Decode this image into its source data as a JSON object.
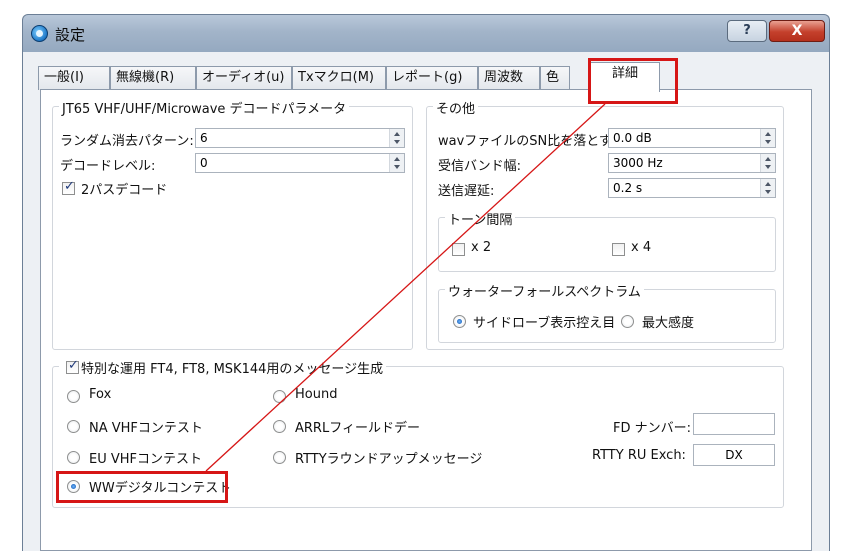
{
  "window": {
    "title": "設定",
    "help_label": "?",
    "close_label": "X"
  },
  "tabs": [
    {
      "label": "一般(I)"
    },
    {
      "label": "無線機(R)"
    },
    {
      "label": "オーディオ(u)"
    },
    {
      "label": "Txマクロ(M)"
    },
    {
      "label": "レポート(g)"
    },
    {
      "label": "周波数"
    },
    {
      "label": "色"
    },
    {
      "label": "詳細"
    }
  ],
  "jt65_group": {
    "title": "JT65 VHF/UHF/Microwave デコードパラメータ",
    "random_erase_label": "ランダム消去パターン:",
    "random_erase_value": "6",
    "decode_level_label": "デコードレベル:",
    "decode_level_value": "0",
    "two_pass_label": "2パスデコード",
    "two_pass_checked": true
  },
  "other_group": {
    "title": "その他",
    "wav_snr_label": "wavファイルのSN比を落とす:",
    "wav_snr_value": "0.0 dB",
    "rx_bandwidth_label": "受信バンド幅:",
    "rx_bandwidth_value": "3000  Hz",
    "tx_delay_label": "送信遅延:",
    "tx_delay_value": "0.2  s",
    "tone_spacing": {
      "title": "トーン間隔",
      "x2_label": "x 2",
      "x4_label": "x 4"
    },
    "waterfall": {
      "title": "ウォーターフォールスペクトラム",
      "option1_label": "サイドローブ表示控え目",
      "option2_label": "最大感度",
      "selected": "サイドローブ表示控え目"
    }
  },
  "special_ops": {
    "title": "特別な運用  FT4, FT8, MSK144用のメッセージ生成",
    "checked": true,
    "fox_label": "Fox",
    "hound_label": "Hound",
    "na_vhf_label": "NA VHFコンテスト",
    "arrl_field_day_label": "ARRLフィールドデー",
    "fd_number_label": "FD ナンバー:",
    "fd_number_value": "",
    "eu_vhf_label": "EU VHFコンテスト",
    "rtty_roundup_label": "RTTYラウンドアップメッセージ",
    "rtty_ru_exch_label": "RTTY RU Exch:",
    "rtty_ru_exch_value": "DX",
    "ww_digi_label": "WWデジタルコンテスト",
    "selected": "WWデジタルコンテスト"
  },
  "annotation": {
    "highlight_color": "#d61616"
  }
}
